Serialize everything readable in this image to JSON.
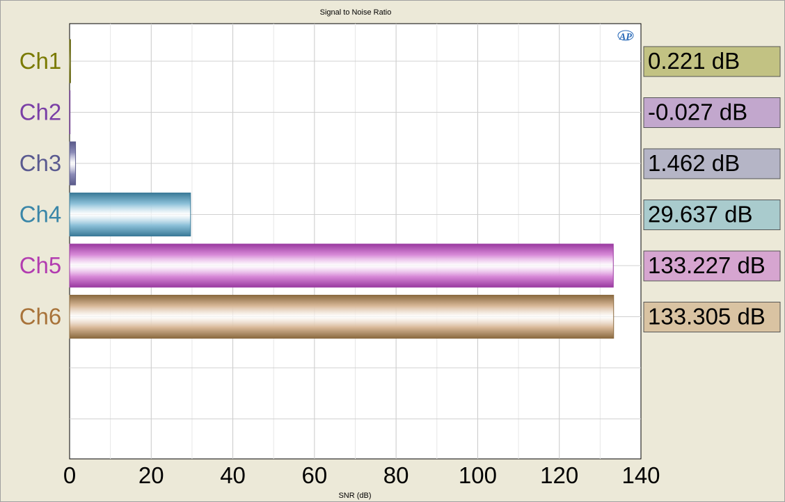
{
  "chart_data": {
    "type": "bar",
    "orientation": "horizontal",
    "title": "Signal to Noise Ratio",
    "xlabel": "SNR (dB)",
    "ylabel": "",
    "xlim": [
      0,
      140
    ],
    "x_ticks": [
      "0",
      "20",
      "40",
      "60",
      "80",
      "100",
      "120",
      "140"
    ],
    "grid": true,
    "categories": [
      "Ch1",
      "Ch2",
      "Ch3",
      "Ch4",
      "Ch5",
      "Ch6"
    ],
    "values": [
      0.221,
      -0.027,
      1.462,
      29.637,
      133.227,
      133.305
    ],
    "value_labels": [
      "0.221 dB",
      "-0.027 dB",
      "1.462 dB",
      "29.637 dB",
      "133.227 dB",
      "133.305 dB"
    ],
    "colors": {
      "label": [
        "#7a7a00",
        "#7a3fa6",
        "#5a5a90",
        "#3a86a8",
        "#b23cb0",
        "#a8733a"
      ],
      "bar": [
        "#8a8a20",
        "#a07ac0",
        "#8c8cb8",
        "#8cc0d8",
        "#d88ad8",
        "#d8b898"
      ],
      "bar_edge": [
        "#5a5a00",
        "#6a3a8a",
        "#5a5a8a",
        "#3a7a98",
        "#9a3aa0",
        "#8a6a40"
      ],
      "box_fill": [
        "#c2c283",
        "#c2a7cd",
        "#b5b5c6",
        "#a9cbcd",
        "#d6a5d0",
        "#d9c3a2"
      ]
    },
    "logo_text": "AP"
  }
}
